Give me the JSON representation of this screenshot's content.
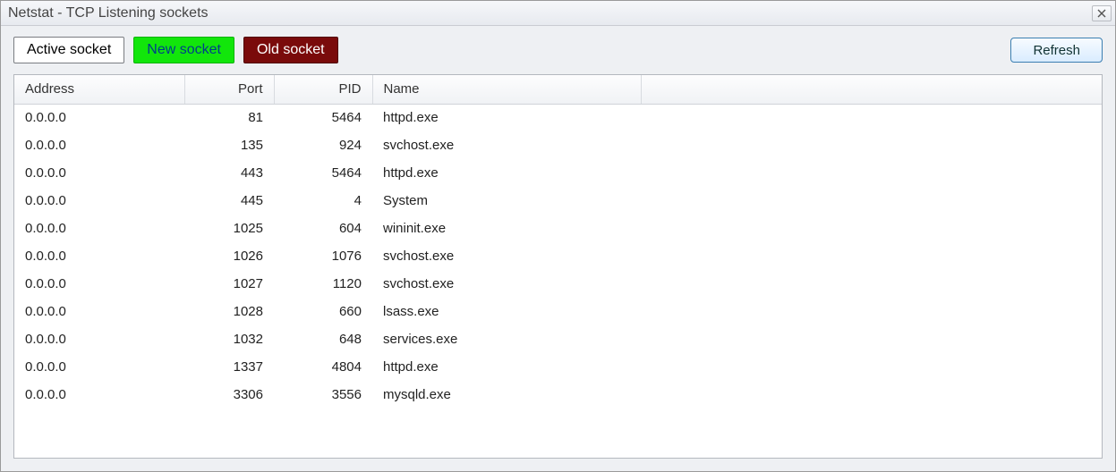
{
  "window": {
    "title": "Netstat - TCP Listening sockets"
  },
  "toolbar": {
    "active_label": "Active socket",
    "new_label": "New socket",
    "old_label": "Old socket",
    "refresh_label": "Refresh"
  },
  "table": {
    "headers": {
      "address": "Address",
      "port": "Port",
      "pid": "PID",
      "name": "Name"
    },
    "rows": [
      {
        "address": "0.0.0.0",
        "port": "81",
        "pid": "5464",
        "name": "httpd.exe"
      },
      {
        "address": "0.0.0.0",
        "port": "135",
        "pid": "924",
        "name": "svchost.exe"
      },
      {
        "address": "0.0.0.0",
        "port": "443",
        "pid": "5464",
        "name": "httpd.exe"
      },
      {
        "address": "0.0.0.0",
        "port": "445",
        "pid": "4",
        "name": "System"
      },
      {
        "address": "0.0.0.0",
        "port": "1025",
        "pid": "604",
        "name": "wininit.exe"
      },
      {
        "address": "0.0.0.0",
        "port": "1026",
        "pid": "1076",
        "name": "svchost.exe"
      },
      {
        "address": "0.0.0.0",
        "port": "1027",
        "pid": "1120",
        "name": "svchost.exe"
      },
      {
        "address": "0.0.0.0",
        "port": "1028",
        "pid": "660",
        "name": "lsass.exe"
      },
      {
        "address": "0.0.0.0",
        "port": "1032",
        "pid": "648",
        "name": "services.exe"
      },
      {
        "address": "0.0.0.0",
        "port": "1337",
        "pid": "4804",
        "name": "httpd.exe"
      },
      {
        "address": "0.0.0.0",
        "port": "3306",
        "pid": "3556",
        "name": "mysqld.exe"
      }
    ]
  }
}
